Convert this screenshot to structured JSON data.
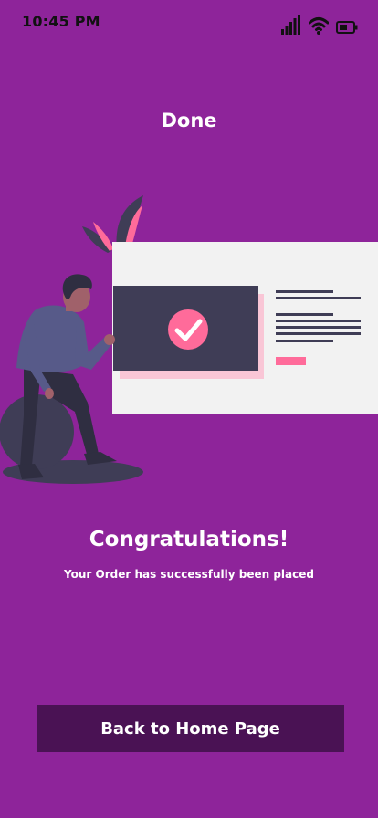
{
  "status_bar": {
    "time": "10:45 PM",
    "icons": [
      "signal-icon",
      "wifi-icon",
      "battery-icon"
    ]
  },
  "page": {
    "title": "Done"
  },
  "message": {
    "title": "Congratulations!",
    "subtitle": "Your Order has successfully been placed"
  },
  "actions": {
    "home_button_label": "Back to Home Page"
  },
  "colors": {
    "background": "#8E249A",
    "button": "#4A1254",
    "accent_pink": "#FF6B9A",
    "dark_card": "#3F3D56",
    "card_white": "#F2F2F2"
  }
}
